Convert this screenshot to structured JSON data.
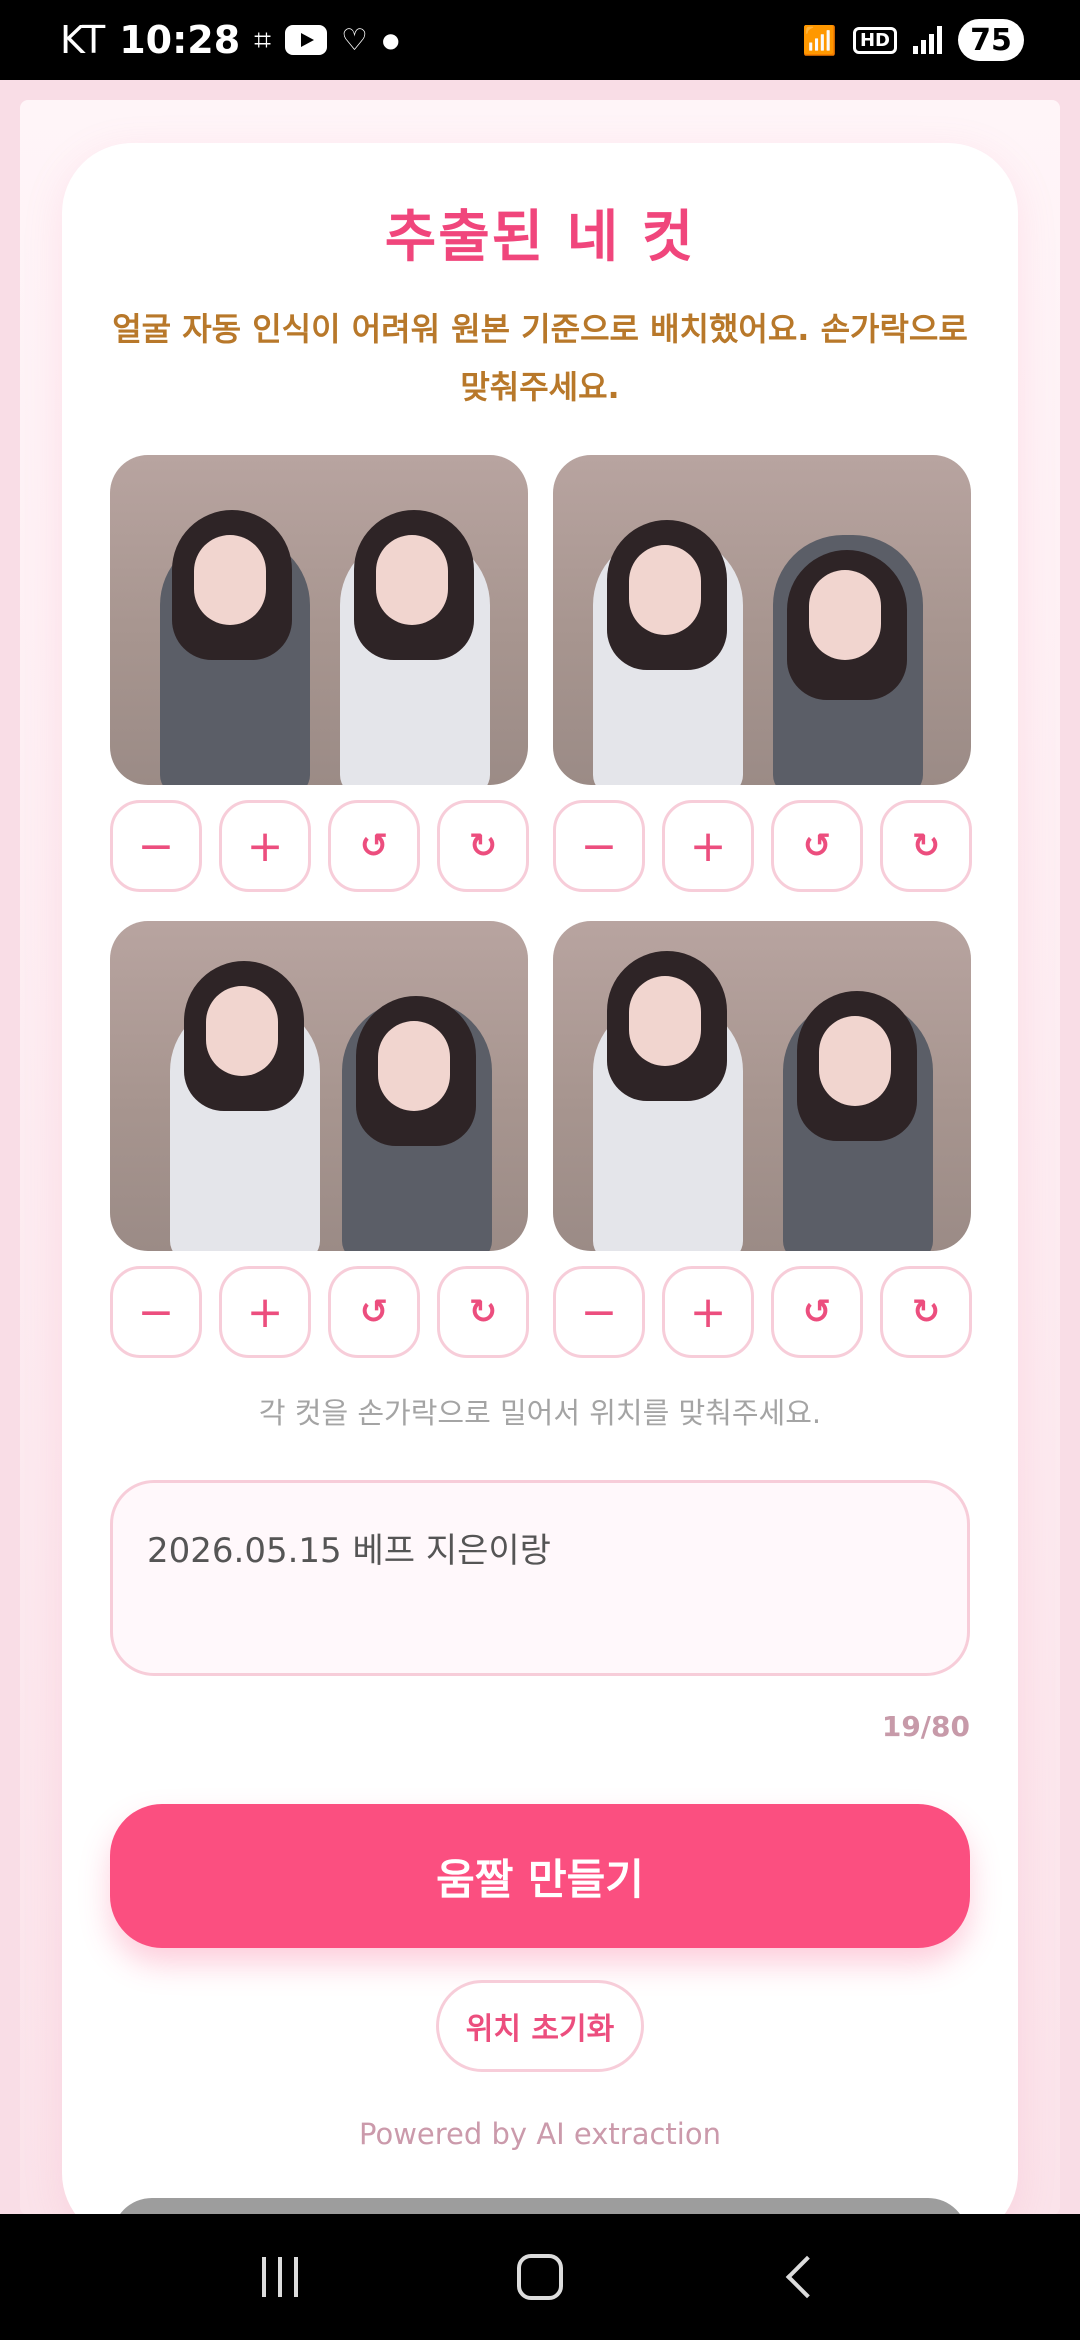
{
  "status_bar": {
    "carrier": "KT",
    "time": "10:28",
    "network": "HD",
    "battery": "75",
    "icons": [
      "screenshot-icon",
      "youtube-icon",
      "heart-app-icon",
      "dot-icon",
      "wifi-icon",
      "hd-icon",
      "signal-icon",
      "battery-icon"
    ]
  },
  "page": {
    "title": "추출된 네 컷",
    "subtitle": "얼굴 자동 인식이 어려워 원본 기준으로 배치했어요. 손가락으로 맞춰주세요.",
    "hint": "각 컷을 손가락으로 밀어서 위치를 맞춰주세요.",
    "caption_value": "2026.05.15 베프 지은이랑",
    "counter": "19/80",
    "make_button": "움짤 만들기",
    "reset_button": "위치 초기화",
    "powered": "Powered by AI extraction"
  },
  "controls": {
    "zoom_out": "−",
    "zoom_in": "+",
    "rotate_left": "↺",
    "rotate_right": "↻"
  },
  "photos": [
    "photo-1",
    "photo-2",
    "photo-3",
    "photo-4"
  ],
  "colors": {
    "accent": "#f0467c",
    "button": "#fb4f80",
    "subtitle": "#b8782a",
    "border": "#f7cdd9"
  }
}
